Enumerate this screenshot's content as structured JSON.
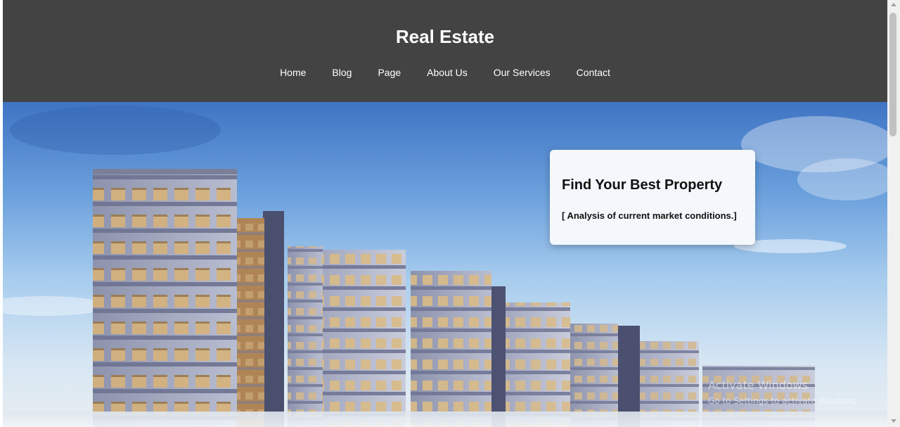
{
  "site": {
    "title": "Real Estate"
  },
  "nav": {
    "items": [
      {
        "label": "Home"
      },
      {
        "label": "Blog"
      },
      {
        "label": "Page"
      },
      {
        "label": "About Us"
      },
      {
        "label": "Our Services"
      },
      {
        "label": "Contact"
      }
    ]
  },
  "hero": {
    "image": "apartment-buildings-photo",
    "card": {
      "heading": "Find Your Best Property",
      "subtext": "[ Analysis of current market conditions.]"
    }
  },
  "watermark": {
    "line1": "Activate Windows",
    "line2": "Go to Settings to activate Windows."
  },
  "colors": {
    "header_bg": "#434343",
    "header_text": "#ffffff",
    "card_bg": "#f4f7fb"
  }
}
